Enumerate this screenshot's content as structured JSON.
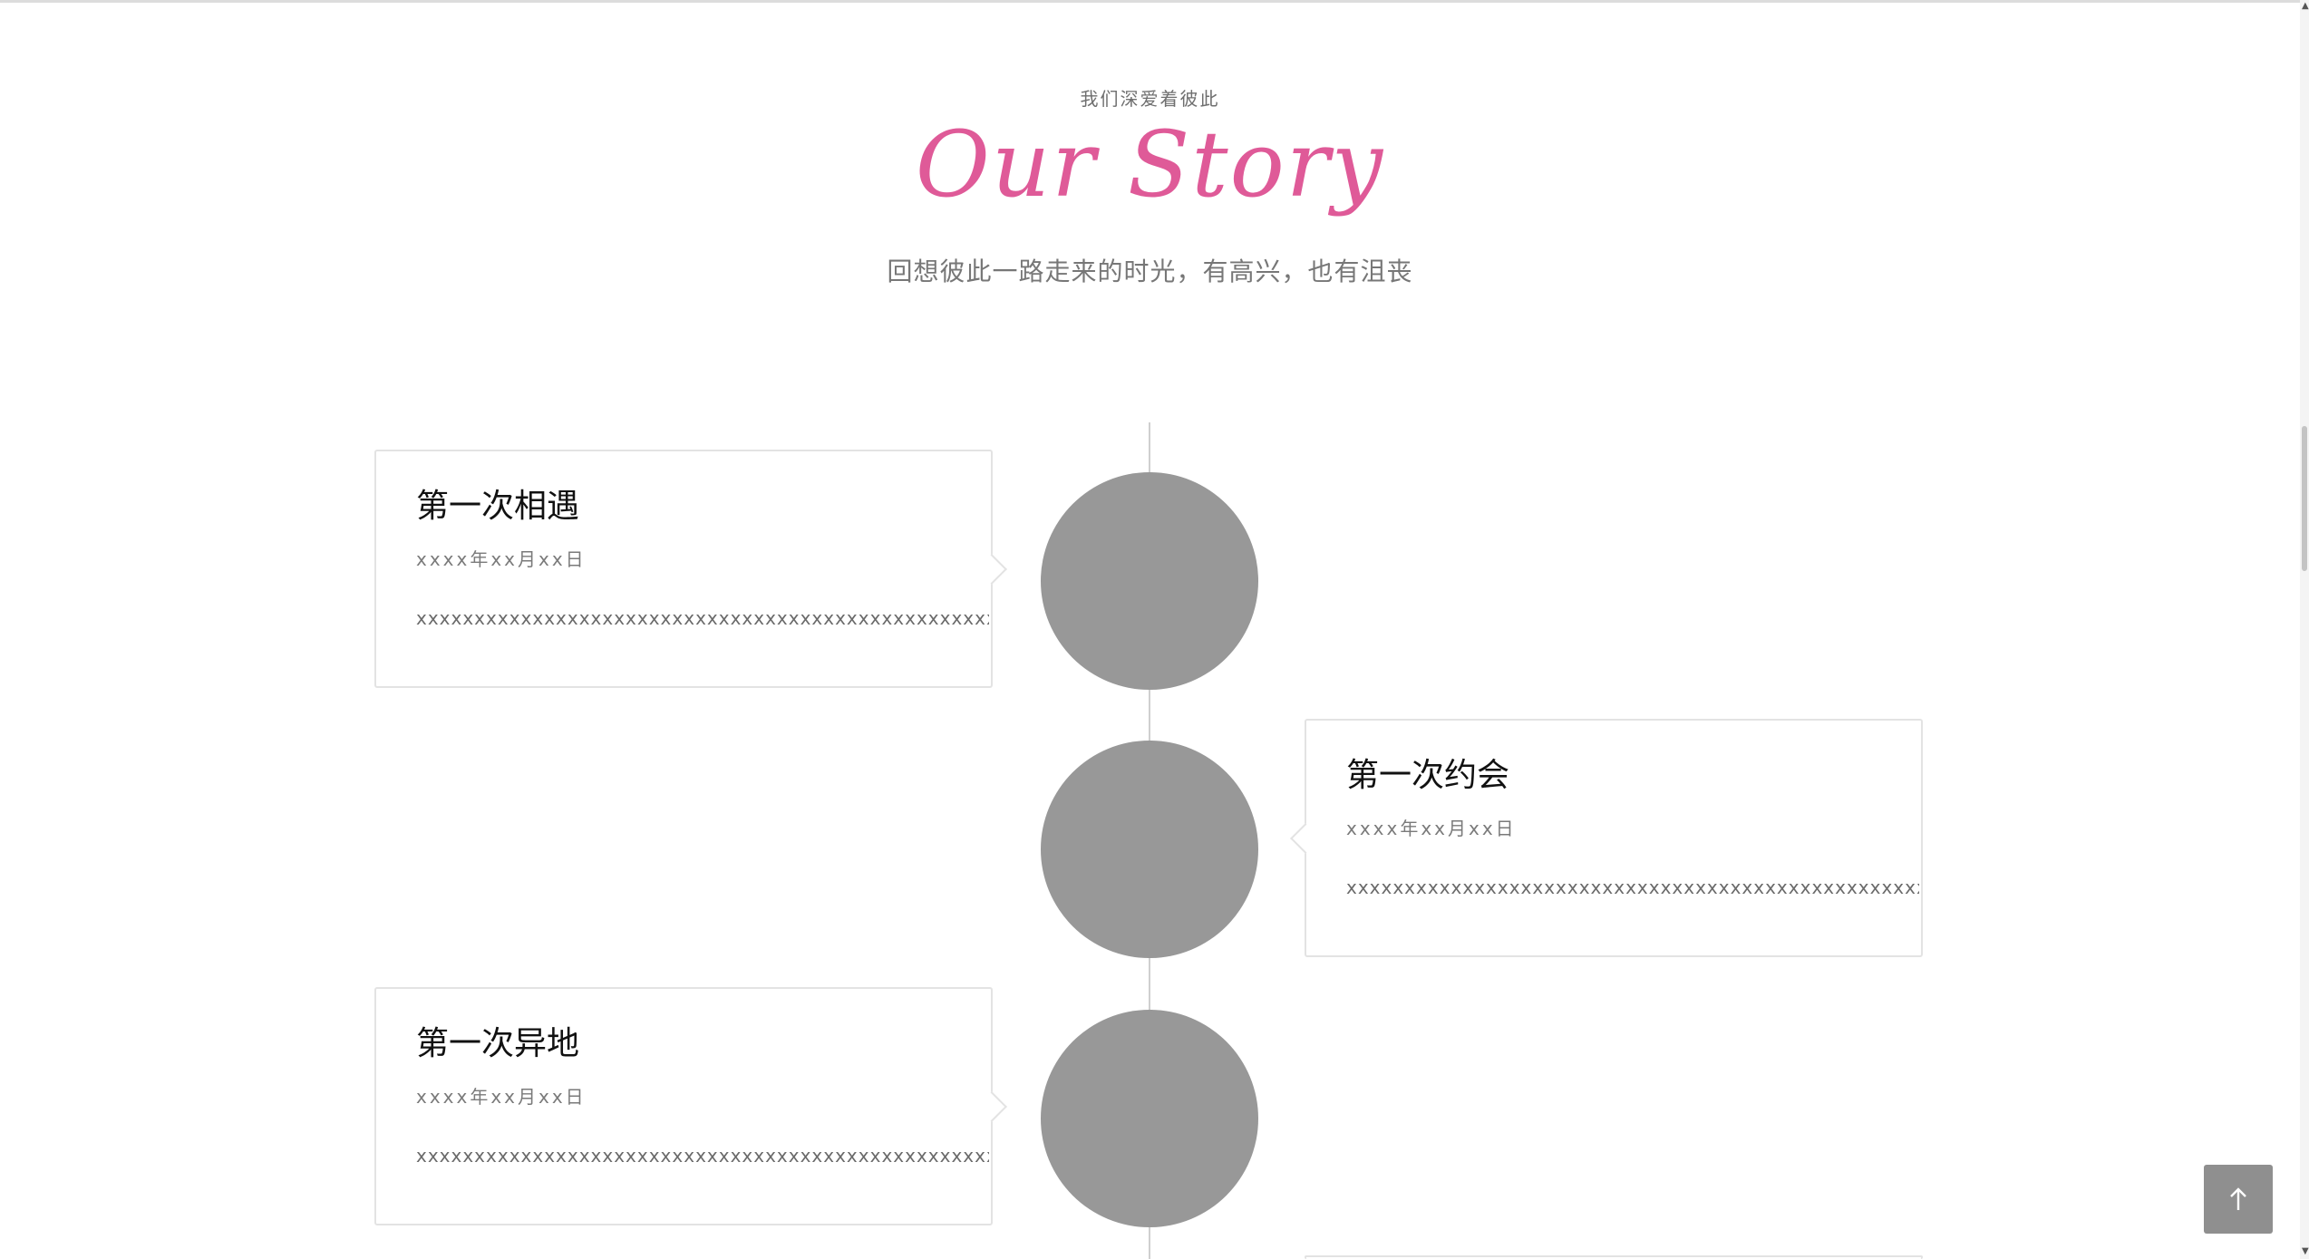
{
  "section": {
    "kicker": "我们深爱着彼此",
    "title": "Our Story",
    "subtitle": "回想彼此一路走来的时光，有高兴，也有沮丧"
  },
  "timeline": [
    {
      "title": "第一次相遇",
      "date": "xxxx年xx月xx日",
      "text": "xxxxxxxxxxxxxxxxxxxxxxxxxxxxxxxxxxxxxxxxxxxxxxxxxx",
      "side": "left"
    },
    {
      "title": "第一次约会",
      "date": "xxxx年xx月xx日",
      "text": "xxxxxxxxxxxxxxxxxxxxxxxxxxxxxxxxxxxxxxxxxxxxxxxxxxxx",
      "side": "right"
    },
    {
      "title": "第一次异地",
      "date": "xxxx年xx月xx日",
      "text": "xxxxxxxxxxxxxxxxxxxxxxxxxxxxxxxxxxxxxxxxxxxxxxxxxxxx",
      "side": "left"
    }
  ],
  "controls": {
    "back_to_top_icon": "arrow-up-icon"
  },
  "colors": {
    "accent": "#df5a98",
    "dot": "#989898",
    "button": "#8f8f8f"
  }
}
